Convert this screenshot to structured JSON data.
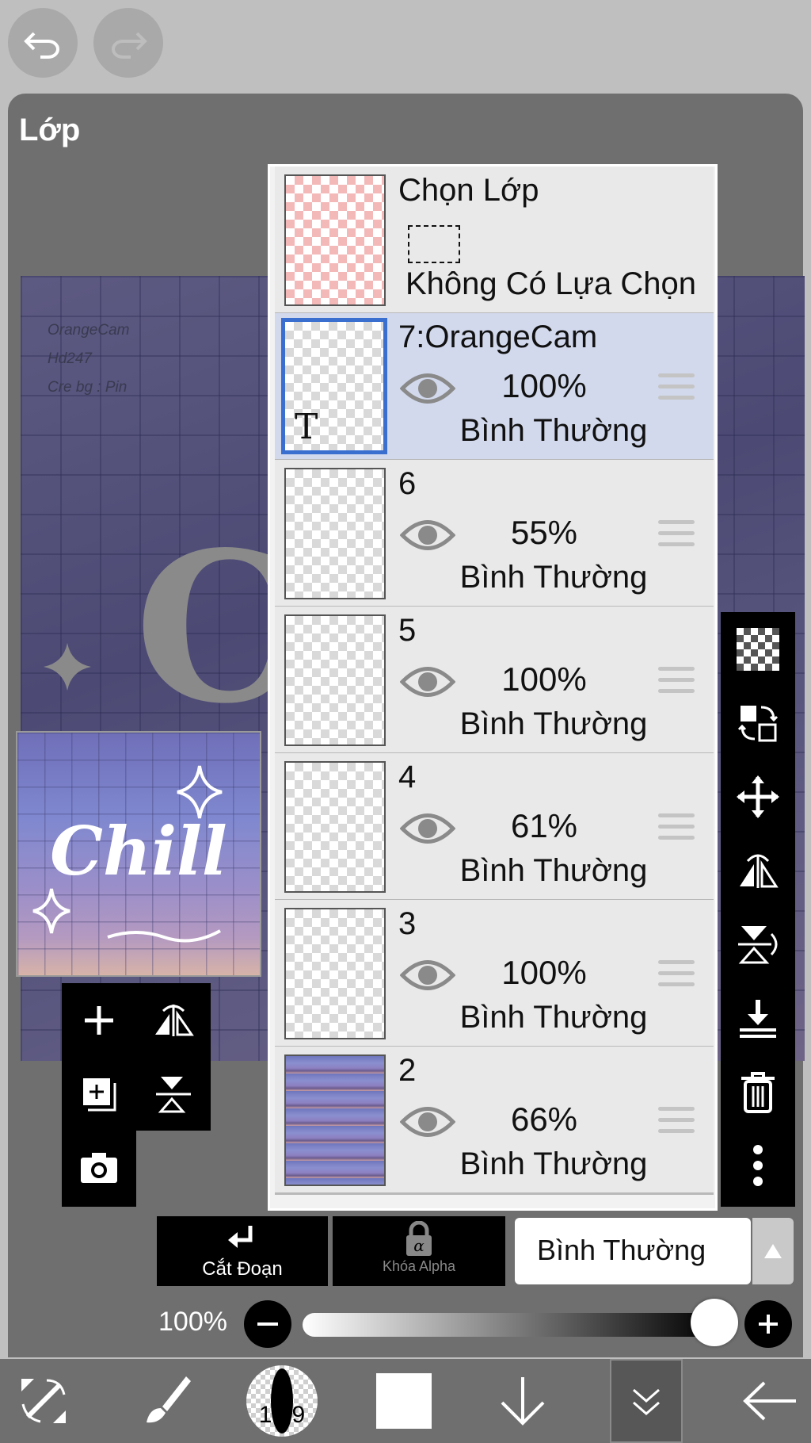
{
  "panel": {
    "title": "Lớp"
  },
  "canvas_credits": [
    "OrangeCam",
    "Hd247",
    "Cre bg : Pin"
  ],
  "preview": {
    "text": "Chill"
  },
  "selection_row": {
    "title": "Chọn Lớp",
    "status": "Không Có Lựa Chọn"
  },
  "layers": [
    {
      "name": "7:OrangeCam",
      "opacity": "100%",
      "mode": "Bình Thường",
      "selected": true
    },
    {
      "name": "6",
      "opacity": "55%",
      "mode": "Bình Thường",
      "selected": false
    },
    {
      "name": "5",
      "opacity": "100%",
      "mode": "Bình Thường",
      "selected": false
    },
    {
      "name": "4",
      "opacity": "61%",
      "mode": "Bình Thường",
      "selected": false
    },
    {
      "name": "3",
      "opacity": "100%",
      "mode": "Bình Thường",
      "selected": false
    },
    {
      "name": "2",
      "opacity": "66%",
      "mode": "Bình Thường",
      "selected": false
    }
  ],
  "controls": {
    "clip_label": "Cắt Đoạn",
    "alpha_lock_label": "Khóa Alpha",
    "blend_mode": "Bình Thường",
    "opacity_label": "100%",
    "opacity_value": 1.0
  },
  "toolbar": {
    "brush_size": "19.9"
  },
  "colors": {
    "accent": "#3a6fd0",
    "panel": "#6f6f6f"
  }
}
